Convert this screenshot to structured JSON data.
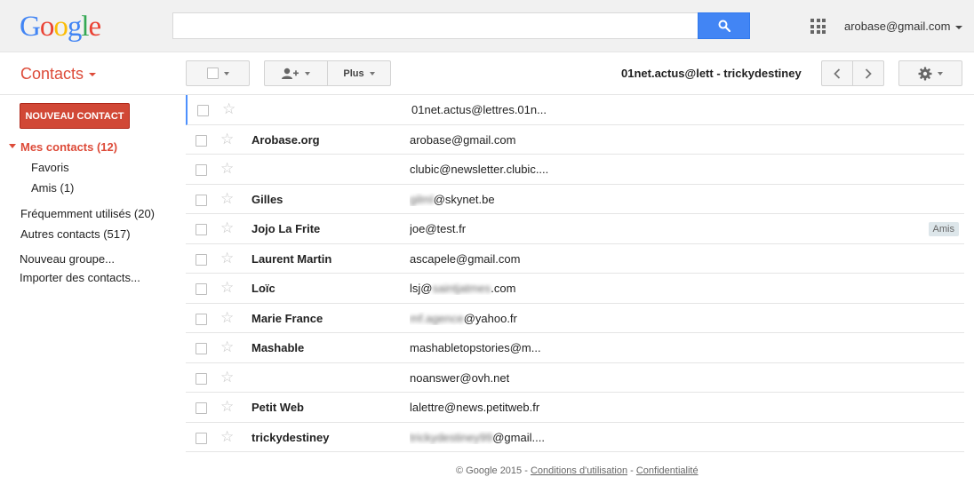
{
  "header": {
    "logo_letters": [
      {
        "ch": "G",
        "color": "#4285f4"
      },
      {
        "ch": "o",
        "color": "#ea4335"
      },
      {
        "ch": "o",
        "color": "#fbbc05"
      },
      {
        "ch": "g",
        "color": "#4285f4"
      },
      {
        "ch": "l",
        "color": "#34a853"
      },
      {
        "ch": "e",
        "color": "#ea4335"
      }
    ],
    "search_value": "",
    "account": "arobase@gmail.com"
  },
  "toolbar": {
    "app_title": "Contacts",
    "more_label": "Plus",
    "breadcrumb": "01net.actus@lett - trickydestiney"
  },
  "sidebar": {
    "new_contact_label": "NOUVEAU CONTACT",
    "my_contacts": "Mes contacts (12)",
    "favorites": "Favoris",
    "friends": "Amis (1)",
    "frequent": "Fréquemment utilisés (20)",
    "other": "Autres contacts (517)",
    "new_group": "Nouveau groupe...",
    "import": "Importer des contacts..."
  },
  "contacts": [
    {
      "name": "",
      "email": "01net.actus@lettres.01n...",
      "email_blur": "",
      "email_suffix": "",
      "tag": ""
    },
    {
      "name": "Arobase.org",
      "email": "arobase@gmail.com",
      "email_blur": "",
      "email_suffix": "",
      "tag": ""
    },
    {
      "name": "",
      "email": "clubic@newsletter.clubic....",
      "email_blur": "",
      "email_suffix": "",
      "tag": ""
    },
    {
      "name": "Gilles",
      "email": "",
      "email_blur": "gilml",
      "email_suffix": "@skynet.be",
      "tag": ""
    },
    {
      "name": "Jojo La Frite",
      "email": "joe@test.fr",
      "email_blur": "",
      "email_suffix": "",
      "tag": "Amis"
    },
    {
      "name": "Laurent Martin",
      "email": "ascapele@gmail.com",
      "email_blur": "",
      "email_suffix": "",
      "tag": ""
    },
    {
      "name": "Loïc",
      "email": "lsj@",
      "email_blur": "saintjatmes",
      "email_suffix": ".com",
      "tag": ""
    },
    {
      "name": "Marie France",
      "email": "",
      "email_blur": "mf.agence",
      "email_suffix": "@yahoo.fr",
      "tag": ""
    },
    {
      "name": "Mashable",
      "email": "mashabletopstories@m...",
      "email_blur": "",
      "email_suffix": "",
      "tag": ""
    },
    {
      "name": "",
      "email": "noanswer@ovh.net",
      "email_blur": "",
      "email_suffix": "",
      "tag": ""
    },
    {
      "name": "Petit Web",
      "email": "lalettre@news.petitweb.fr",
      "email_blur": "",
      "email_suffix": "",
      "tag": ""
    },
    {
      "name": "trickydestiney",
      "email": "",
      "email_blur": "trickydestiney99",
      "email_suffix": "@gmail....",
      "tag": ""
    }
  ],
  "footer": {
    "copyright": "© Google 2015 -",
    "terms": "Conditions d'utilisation",
    "dash": "-",
    "privacy": "Confidentialité"
  },
  "colors": {
    "accent_red": "#dd4b39",
    "button_red": "#d14836",
    "search_blue": "#4285f4",
    "selection_blue": "#4d90fe"
  }
}
